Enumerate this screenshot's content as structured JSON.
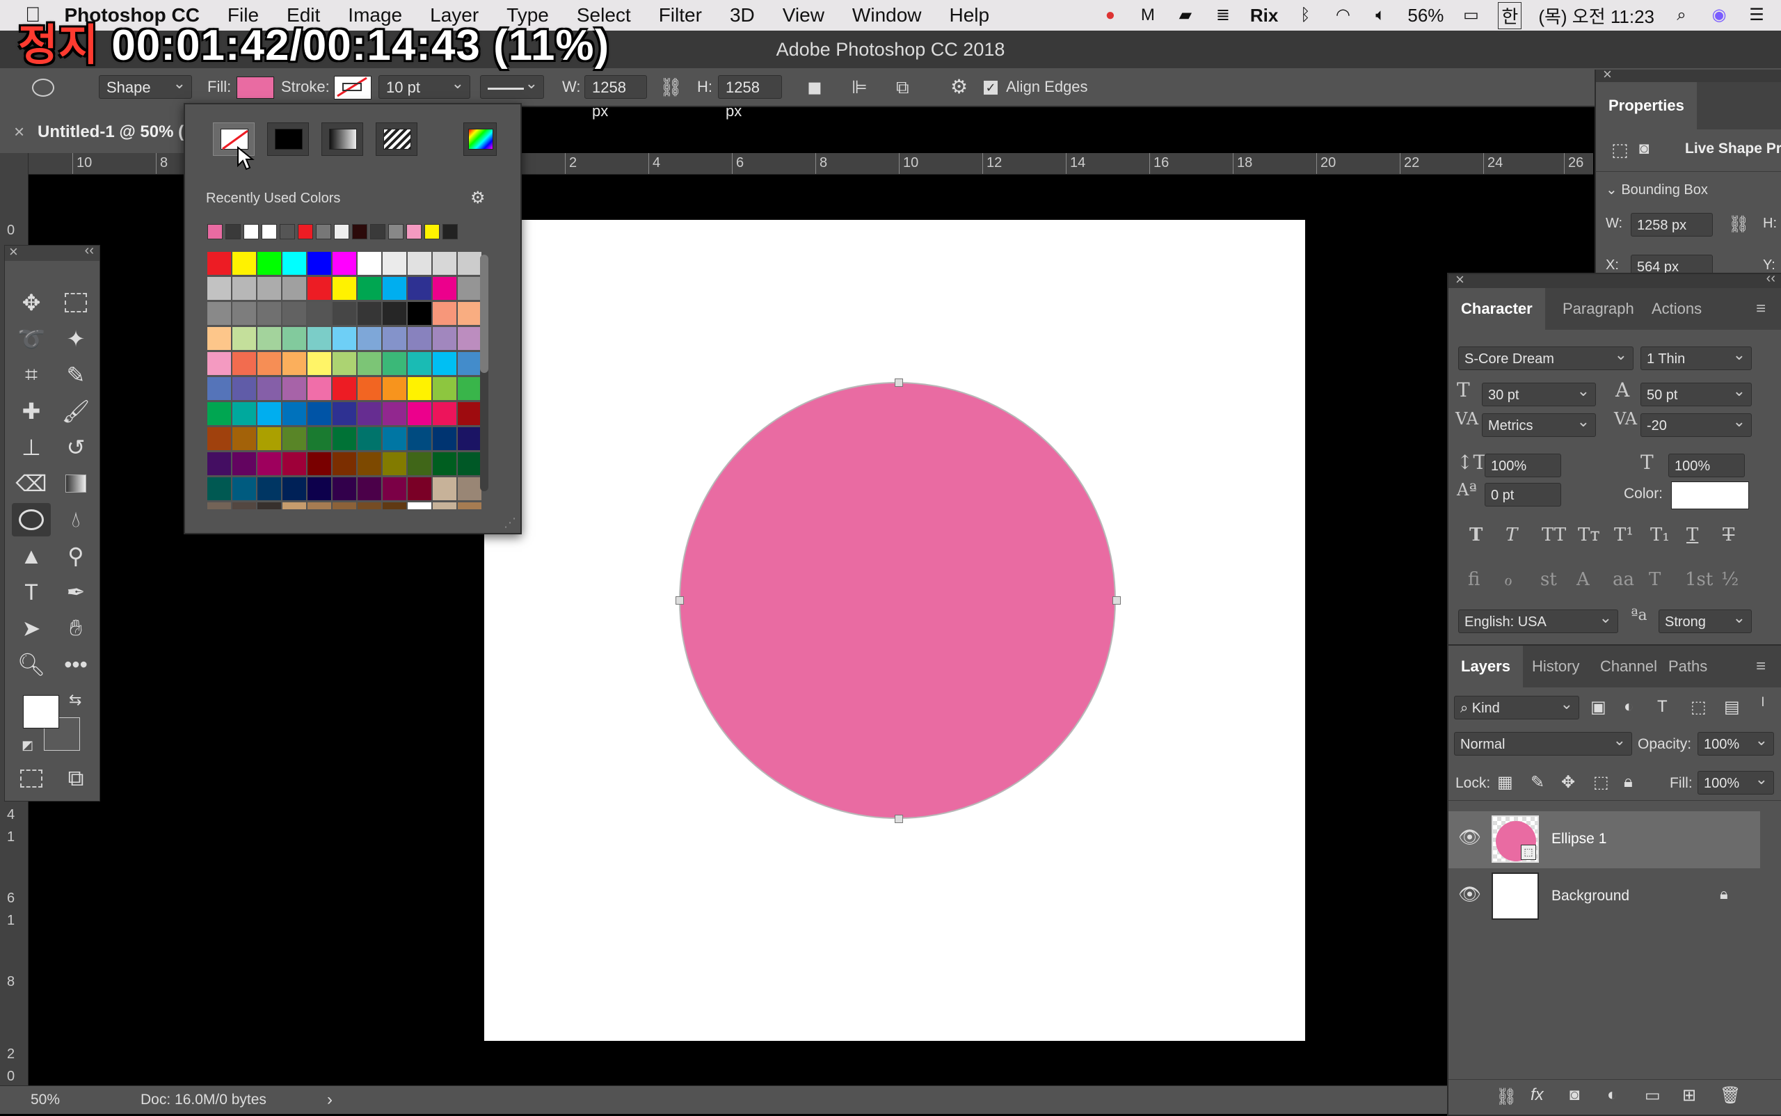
{
  "overlay": {
    "state": "정지",
    "time": "00:01:42/00:14:43 (11%)"
  },
  "menubar": {
    "app": "Photoshop CC",
    "menus": [
      "File",
      "Edit",
      "Image",
      "Layer",
      "Type",
      "Select",
      "Filter",
      "3D",
      "View",
      "Window",
      "Help"
    ],
    "status_text": "Rix",
    "battery": "56%",
    "input_lang": "한",
    "clock": "(목) 오전 11:23"
  },
  "window_title": "Adobe Photoshop CC 2018",
  "options": {
    "tool_mode": "Shape",
    "fill_label": "Fill:",
    "fill_color": "#e96ba2",
    "stroke_label": "Stroke:",
    "stroke_width": "10 pt",
    "w_label": "W:",
    "w_value": "1258 px",
    "h_label": "H:",
    "h_value": "1258 px",
    "align_edges": "Align Edges"
  },
  "doc_tab": "Untitled-1 @ 50% (",
  "ruler": {
    "h_ticks": [
      "10",
      "8",
      "2",
      "4",
      "6",
      "8",
      "10",
      "12",
      "14",
      "16",
      "18",
      "20",
      "22",
      "24",
      "26"
    ],
    "v_ticks": [
      "0",
      "4",
      "1",
      "6",
      "1",
      "8",
      "2",
      "0"
    ]
  },
  "swatch_popup": {
    "recent_label": "Recently Used Colors",
    "recent": [
      "#e96ba2",
      "#3a3a3a",
      "#ffffff",
      "#ffffff",
      "#555555",
      "#ed1c24",
      "#777777",
      "#eeeeee",
      "#2b0a0a",
      "#3a3a3a",
      "#888888",
      "#f49ac1",
      "#fff200",
      "#222222"
    ],
    "grid": [
      [
        "#ed1c24",
        "#fff200",
        "#00ff00",
        "#00ffff",
        "#0000ff",
        "#ff00ff",
        "#ffffff",
        "#ebebeb",
        "#e1e1e1",
        "#d7d7d7",
        "#cccccc"
      ],
      [
        "#c2c2c2",
        "#b7b7b7",
        "#acacac",
        "#a0a0a0",
        "#ed1c24",
        "#fff200",
        "#00a651",
        "#00aeef",
        "#2e3192",
        "#ec008c",
        "#959595"
      ],
      [
        "#898989",
        "#7d7d7d",
        "#707070",
        "#626262",
        "#555555",
        "#464646",
        "#363636",
        "#262626",
        "#000000",
        "#f7977a",
        "#f9ad81"
      ],
      [
        "#fdc68a",
        "#c4df9b",
        "#a3d39c",
        "#82ca9d",
        "#7bcdc8",
        "#6ecff6",
        "#7ea7d8",
        "#8493ca",
        "#8882be",
        "#a187be",
        "#bc8dbf"
      ],
      [
        "#f49ac1",
        "#f26c4f",
        "#f68e55",
        "#fbaf5c",
        "#fff467",
        "#acd372",
        "#7cc576",
        "#3bb878",
        "#1abbb4",
        "#00bff3",
        "#438ccb"
      ],
      [
        "#5574b9",
        "#605ca8",
        "#855fa8",
        "#a763a8",
        "#f06ea9",
        "#ed1c24",
        "#f26522",
        "#f7941d",
        "#fff200",
        "#8dc63f",
        "#39b54a"
      ],
      [
        "#00a651",
        "#00a99d",
        "#00aeef",
        "#0072bc",
        "#0054a6",
        "#2e3192",
        "#662d91",
        "#92278f",
        "#ec008c",
        "#ed145b",
        "#9e0b0f"
      ],
      [
        "#a0410d",
        "#a36209",
        "#aba000",
        "#598527",
        "#1a7b30",
        "#007236",
        "#00746b",
        "#0076a3",
        "#004b80",
        "#003471",
        "#1b1464"
      ],
      [
        "#440e62",
        "#630460",
        "#9e005d",
        "#9e0039",
        "#790000",
        "#7b2e00",
        "#7d4900",
        "#827b00",
        "#406618",
        "#005e20",
        "#005826"
      ],
      [
        "#005952",
        "#005b7f",
        "#003663",
        "#002157",
        "#0d004c",
        "#32004b",
        "#4b0049",
        "#7b0046",
        "#7a0026",
        "#c7b299",
        "#998675"
      ],
      [
        "#736357",
        "#534741",
        "#37302d",
        "#c69c6d",
        "#a67c52",
        "#8c6239",
        "#754c24",
        "#603913",
        "#ffffff",
        "#c7b299",
        "#a67c52"
      ]
    ]
  },
  "properties": {
    "title": "Properties",
    "subtitle": "Live Shape Pr",
    "section": "Bounding Box",
    "w_label": "W:",
    "w_value": "1258 px",
    "h_label": "H:",
    "x_label": "X:",
    "x_value": "564 px",
    "y_label": "Y:"
  },
  "character": {
    "tabs": [
      "Character",
      "Paragraph",
      "Actions"
    ],
    "font_family": "S-Core Dream",
    "font_style": "1 Thin",
    "size": "30 pt",
    "leading": "50 pt",
    "kerning": "Metrics",
    "tracking": "-20",
    "vscale": "100%",
    "hscale": "100%",
    "baseline": "0 pt",
    "color_label": "Color:",
    "language": "English: USA",
    "antialias": "Strong",
    "style_glyphs": [
      "T",
      "T",
      "TT",
      "Tт",
      "T¹",
      "T₁",
      "T",
      "T"
    ],
    "ot_glyphs": [
      "ﬁ",
      "ℴ",
      "st",
      "A",
      "aa",
      "T",
      "1st",
      "½"
    ]
  },
  "layers": {
    "tabs": [
      "Layers",
      "History",
      "Channel",
      "Paths"
    ],
    "filter": "Kind",
    "blend": "Normal",
    "opacity_label": "Opacity:",
    "opacity": "100%",
    "lock_label": "Lock:",
    "fill_label": "Fill:",
    "fill": "100%",
    "items": [
      {
        "name": "Ellipse 1"
      },
      {
        "name": "Background"
      }
    ]
  },
  "status": {
    "zoom": "50%",
    "doc": "Doc: 16.0M/0 bytes"
  }
}
